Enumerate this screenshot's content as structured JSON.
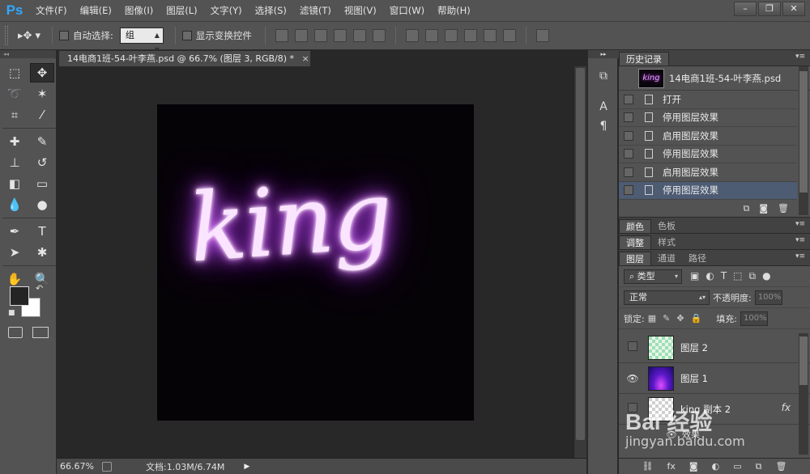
{
  "app": {
    "logo": "Ps",
    "menu": [
      "文件(F)",
      "编辑(E)",
      "图像(I)",
      "图层(L)",
      "文字(Y)",
      "选择(S)",
      "滤镜(T)",
      "视图(V)",
      "窗口(W)",
      "帮助(H)"
    ],
    "window_controls": [
      "–",
      "❐",
      "✕"
    ]
  },
  "options": {
    "auto_select_label": "自动选择:",
    "auto_select_value": "组",
    "show_transform_label": "显示变换控件"
  },
  "document": {
    "tab_title": "14电商1班-54-叶李燕.psd @ 66.7% (图层 3, RGB/8) *",
    "tab_close": "×",
    "artwork_text": "king"
  },
  "status": {
    "zoom": "66.67%",
    "doc_size": "文档:1.03M/6.74M"
  },
  "history_panel": {
    "tab": "历史记录",
    "snapshot_name": "14电商1班-54-叶李燕.psd",
    "snapshot_thumb_text": "king",
    "items": [
      "打开",
      "停用图层效果",
      "启用图层效果",
      "停用图层效果",
      "启用图层效果",
      "停用图层效果"
    ]
  },
  "color_panel": {
    "tabs": [
      "颜色",
      "色板"
    ]
  },
  "adjust_panel": {
    "tabs": [
      "调整",
      "样式"
    ]
  },
  "layers_panel": {
    "tabs": [
      "图层",
      "通道",
      "路径"
    ],
    "filter_type": "类型",
    "blend_mode": "正常",
    "opacity_label": "不透明度:",
    "opacity_value": "100%",
    "lock_label": "锁定:",
    "fill_label": "填充:",
    "fill_value": "100%",
    "layers": [
      {
        "name": "图层 2",
        "visible": false
      },
      {
        "name": "图层 1",
        "visible": true
      },
      {
        "name": "king 副本 2",
        "visible": false
      }
    ],
    "effects_label": "效果",
    "fx_label": "fx"
  },
  "watermark": {
    "main": "Bai 经验",
    "sub": "jingyan.baidu.com"
  },
  "colors": {
    "accent": "#31a8ff",
    "glow": "#c85cff",
    "selected_row": "#4d5b73"
  }
}
